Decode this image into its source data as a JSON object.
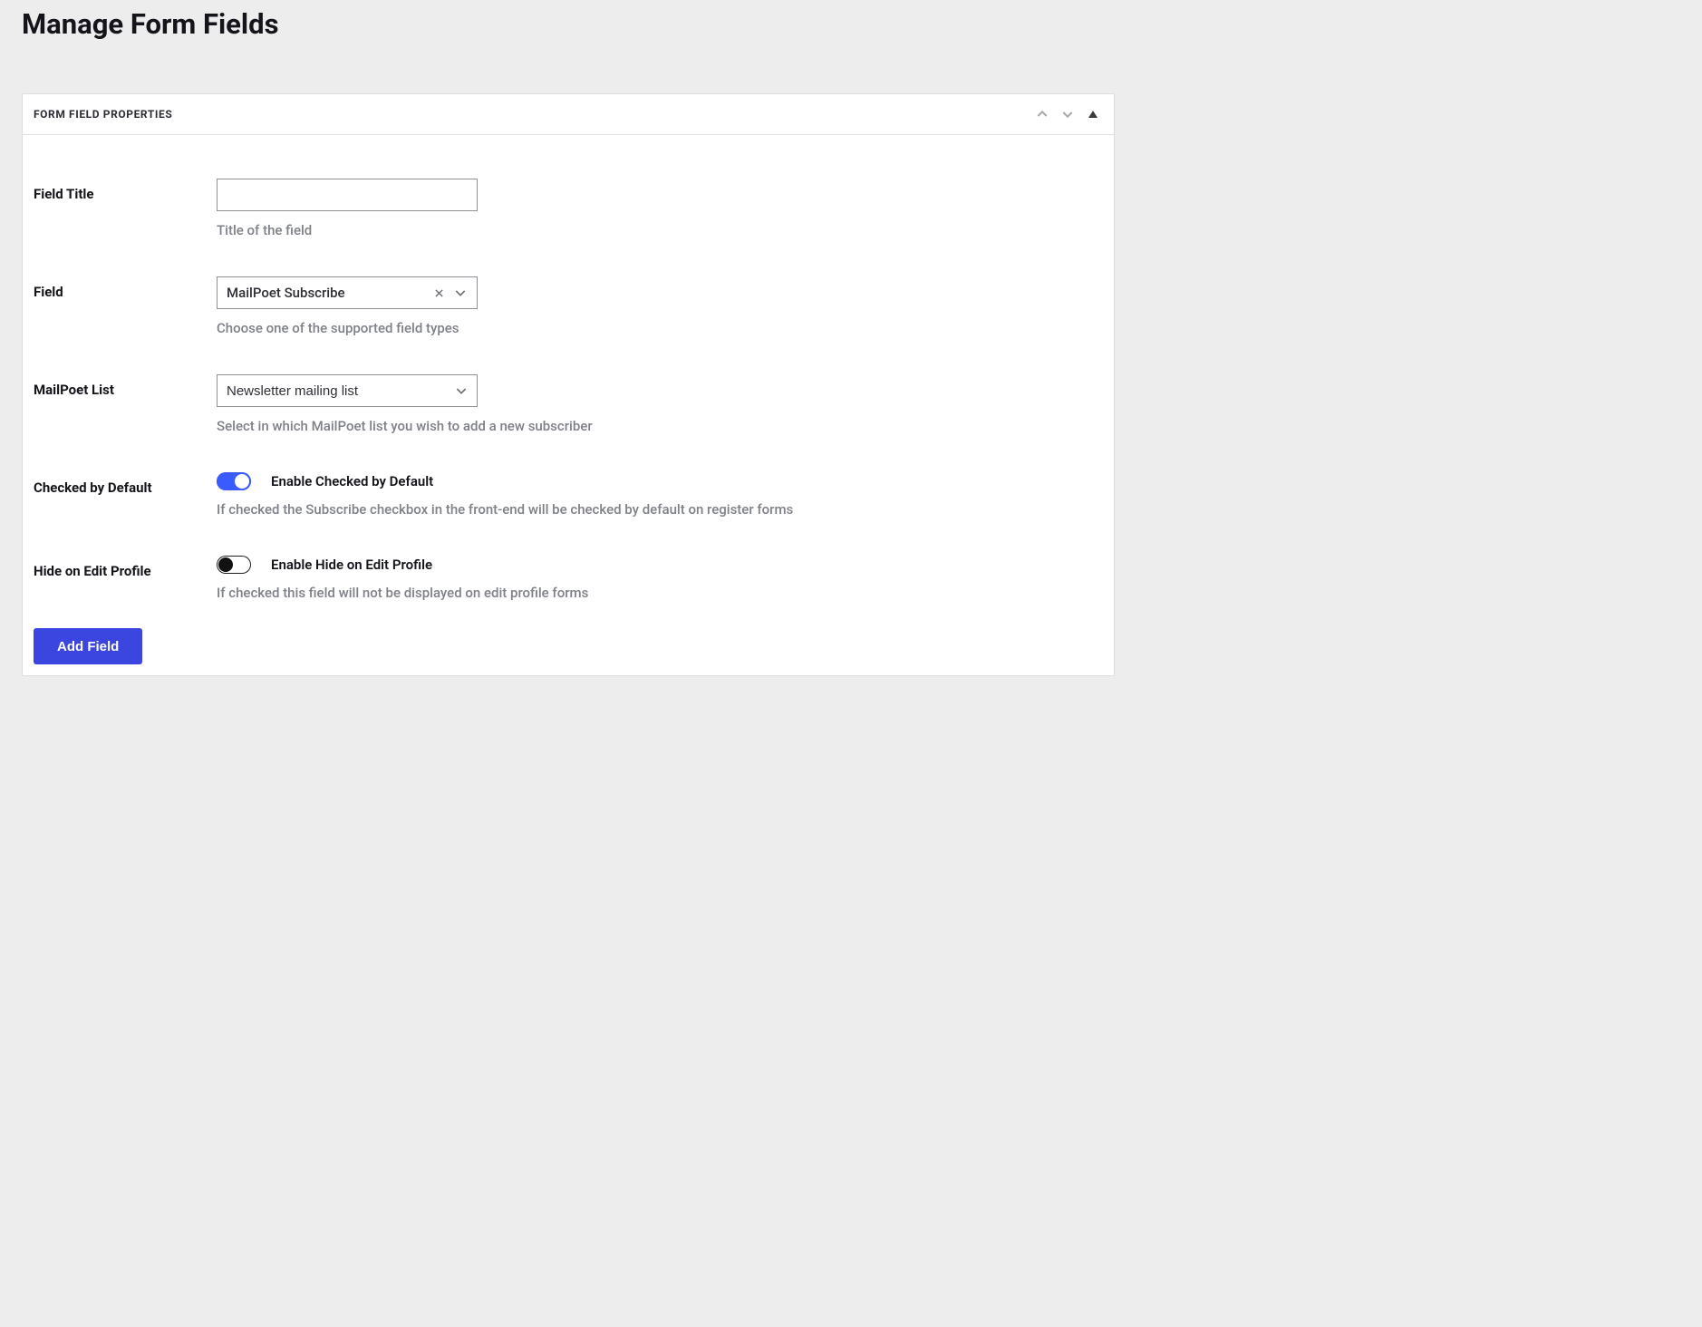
{
  "page": {
    "title": "Manage Form Fields"
  },
  "panel": {
    "title": "FORM FIELD PROPERTIES"
  },
  "fields": {
    "title": {
      "label": "Field Title",
      "value": "",
      "help": "Title of the field"
    },
    "type": {
      "label": "Field",
      "value": "MailPoet Subscribe",
      "help": "Choose one of the supported field types"
    },
    "list": {
      "label": "MailPoet List",
      "value": "Newsletter mailing list",
      "help": "Select in which MailPoet list you wish to add a new subscriber"
    },
    "checked_default": {
      "label": "Checked by Default",
      "toggle_label": "Enable Checked by Default",
      "help": "If checked the Subscribe checkbox in the front-end will be checked by default on register forms",
      "enabled": true
    },
    "hide_profile": {
      "label": "Hide on Edit Profile",
      "toggle_label": "Enable Hide on Edit Profile",
      "help": "If checked this field will not be displayed on edit profile forms",
      "enabled": false
    }
  },
  "actions": {
    "add": "Add Field"
  },
  "colors": {
    "accent": "#3b46e0",
    "toggle_on": "#3a5cff"
  }
}
